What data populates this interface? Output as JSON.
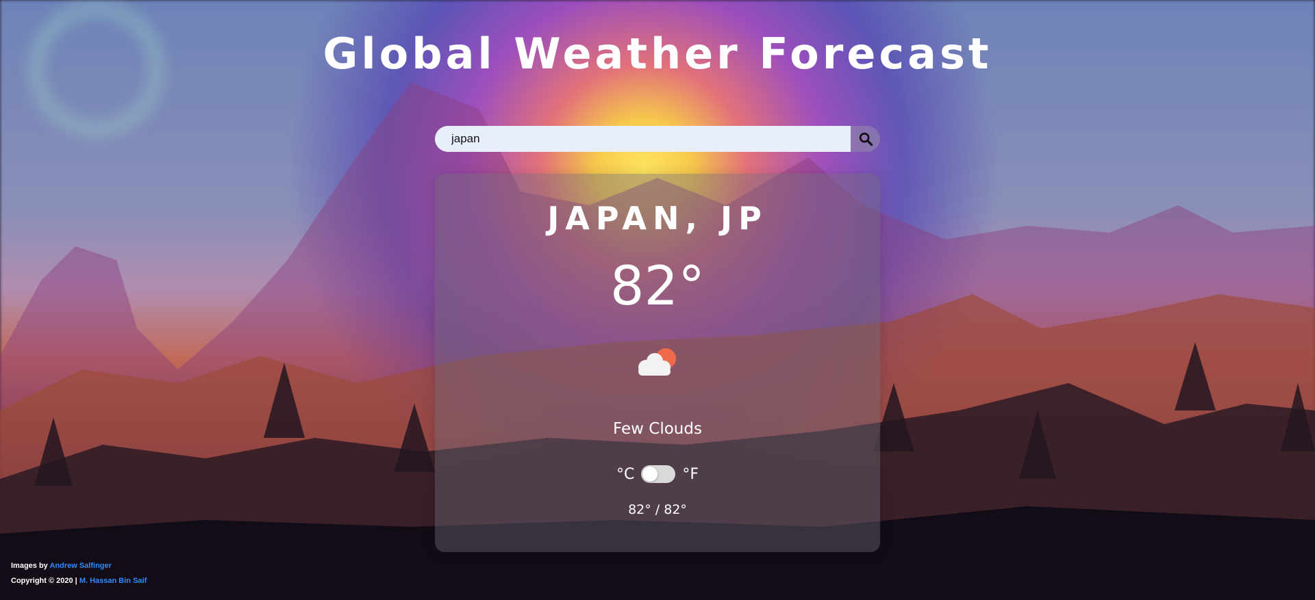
{
  "page": {
    "title": "Global Weather Forecast"
  },
  "search": {
    "value": "japan",
    "icon": "search-icon"
  },
  "weather": {
    "location": "JAPAN, JP",
    "temperature": "82°",
    "icon": "few-clouds-icon",
    "description": "Few Clouds",
    "unit_celsius": "°C",
    "unit_fahrenheit": "°F",
    "unit_toggle_on": false,
    "range": "82° / 82°"
  },
  "footer": {
    "images_prefix": "Images by ",
    "images_author": "Andrew Salfinger",
    "copyright_prefix": "Copyright © 2020 | ",
    "copyright_author": "M. Hassan Bin Saif"
  },
  "colors": {
    "link": "#2f8cff",
    "search_bg": "#e8eefc",
    "sun": "#ef6a4a",
    "cloud": "#f2f2f2"
  }
}
